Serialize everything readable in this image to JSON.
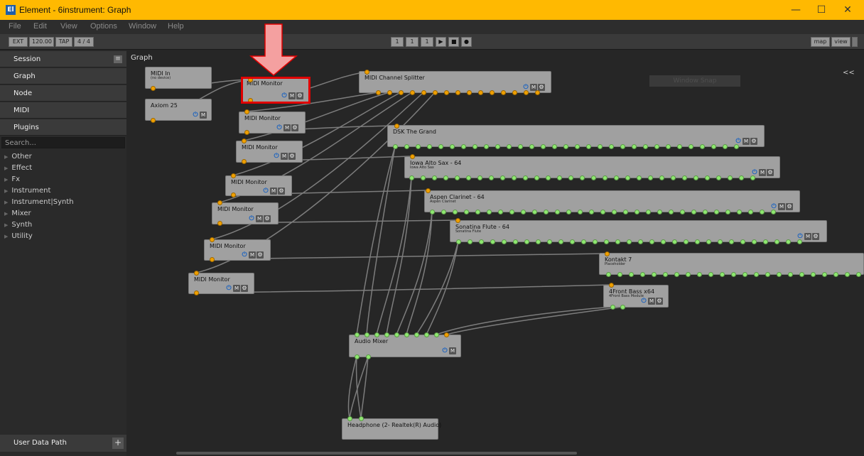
{
  "window": {
    "title": "Element - 6instrument: Graph",
    "app_icon": "El",
    "minimize": "—",
    "maximize": "☐",
    "close": "✕"
  },
  "menu": [
    "File",
    "Edit",
    "View",
    "Options",
    "Window",
    "Help"
  ],
  "toolbar": {
    "ext": "EXT",
    "tempo": "120.00",
    "tap": "TAP",
    "meter": "4 / 4",
    "bar": "1",
    "beat": "1",
    "tick": "1",
    "map": "map",
    "view": "view"
  },
  "sidebar": {
    "tabs": [
      "Session",
      "Graph",
      "Node",
      "MIDI",
      "Plugins"
    ],
    "search_placeholder": "Search...",
    "categories": [
      "Other",
      "Effect",
      "Fx",
      "Instrument",
      "Instrument|Synth",
      "Mixer",
      "Synth",
      "Utility"
    ],
    "user_data_path": "User Data Path",
    "add": "+"
  },
  "graph": {
    "label": "Graph",
    "collapse": "<<",
    "window_snap": "Window Snap"
  },
  "nodes": [
    {
      "name": "MIDI In",
      "subtitle": "(no device)"
    },
    {
      "name": "Axiom 25"
    },
    {
      "name": "MIDI Monitor"
    },
    {
      "name": "MIDI Channel Splitter"
    },
    {
      "name": "MIDI Monitor"
    },
    {
      "name": "MIDI Monitor"
    },
    {
      "name": "MIDI Monitor"
    },
    {
      "name": "MIDI Monitor"
    },
    {
      "name": "MIDI Monitor"
    },
    {
      "name": "MIDI Monitor"
    },
    {
      "name": "DSK The Grand"
    },
    {
      "name": "Iowa Alto Sax - 64",
      "subtitle": "Iowa Alto Sax"
    },
    {
      "name": "Aspen Clarinet - 64",
      "subtitle": "Aspen Clarinet"
    },
    {
      "name": "Sonatina Flute - 64",
      "subtitle": "Sonatina Flute"
    },
    {
      "name": "Kontakt 7",
      "subtitle": "Placeholder"
    },
    {
      "name": "4Front Bass x64",
      "subtitle": "4Front Bass Module"
    },
    {
      "name": "Audio Mixer"
    },
    {
      "name": "Headphone (2- Realtek(R) Audio)"
    }
  ],
  "controls": {
    "power": "⏻",
    "mute": "M",
    "gear": "⚙"
  },
  "colors": {
    "titlebar": "#FFB901",
    "midi_port": "#F0A000",
    "audio_port": "#8EE870",
    "highlight": "#E00000",
    "arrow": "#F4A0A0"
  }
}
